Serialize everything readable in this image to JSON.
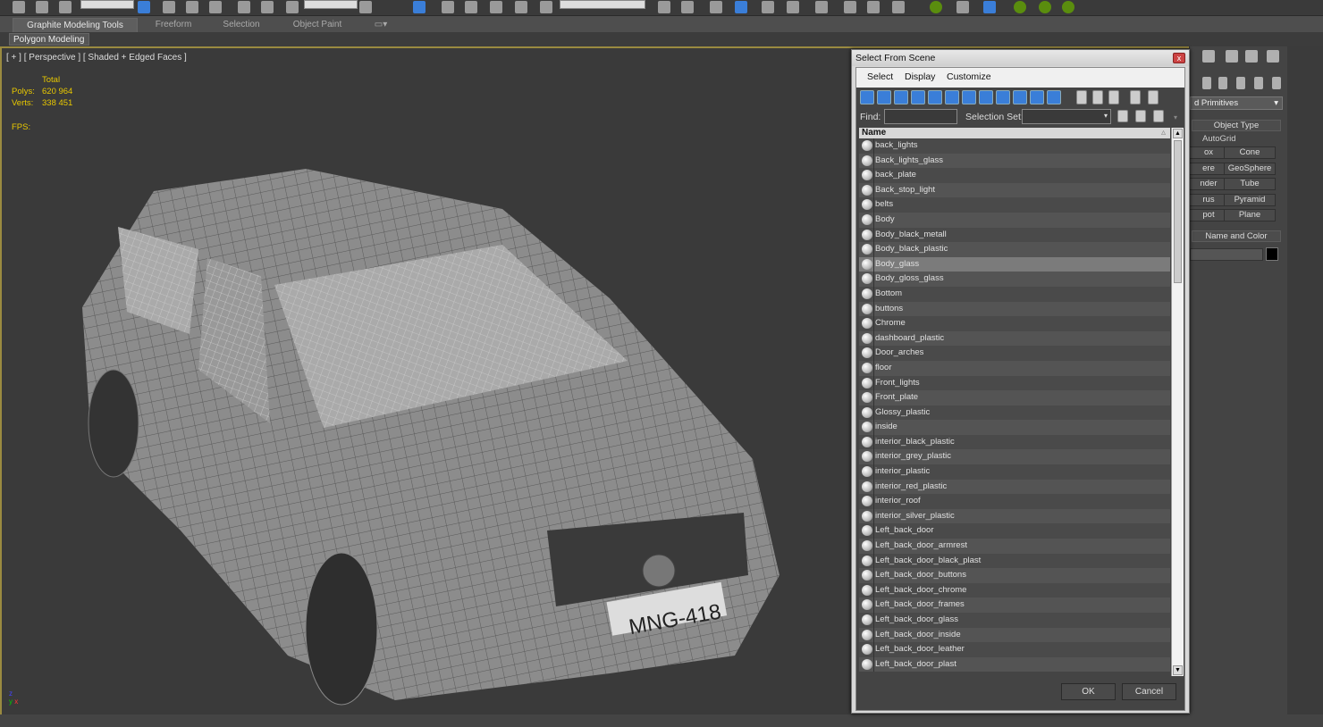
{
  "ribbon": {
    "tabs": [
      "Graphite Modeling Tools",
      "Freeform",
      "Selection",
      "Object Paint"
    ],
    "active": 0,
    "sub_label": "Polygon Modeling"
  },
  "viewport": {
    "label": "[ + ] [ Perspective ] [ Shaded + Edged Faces ]",
    "stats": {
      "total_label": "Total",
      "polys_label": "Polys:",
      "polys": "620 964",
      "verts_label": "Verts:",
      "verts": "338 451",
      "fps_label": "FPS:"
    },
    "plate": "MNG-418",
    "stats_color": "#e8c800",
    "border_color": "#9a8a40"
  },
  "command_panel": {
    "category": "d Primitives",
    "object_type": "Object Type",
    "autogrid": "AutoGrid",
    "buttons": [
      [
        "ox",
        "Cone"
      ],
      [
        "ere",
        "GeoSphere"
      ],
      [
        "nder",
        "Tube"
      ],
      [
        "rus",
        "Pyramid"
      ],
      [
        "pot",
        "Plane"
      ]
    ],
    "name_and_color": "Name and Color",
    "swatch_color": "#000000"
  },
  "dialog": {
    "title": "Select From Scene",
    "close": "x",
    "menus": [
      "Select",
      "Display",
      "Customize"
    ],
    "find_label": "Find:",
    "find_value": "",
    "selection_set_label": "Selection Set:",
    "selection_set_value": "",
    "column_header": "Name",
    "selected_index": 8,
    "items": [
      "back_lights",
      "Back_lights_glass",
      "back_plate",
      "Back_stop_light",
      "belts",
      "Body",
      "Body_black_metall",
      "Body_black_plastic",
      "Body_glass",
      "Body_gloss_glass",
      "Bottom",
      "buttons",
      "Chrome",
      "dashboard_plastic",
      "Door_arches",
      "floor",
      "Front_lights",
      "Front_plate",
      "Glossy_plastic",
      "inside",
      "interior_black_plastic",
      "interior_grey_plastic",
      "interior_plastic",
      "interior_red_plastic",
      "interior_roof",
      "interior_silver_plastic",
      "Left_back_door",
      "Left_back_door_armrest",
      "Left_back_door_black_plast",
      "Left_back_door_buttons",
      "Left_back_door_chrome",
      "Left_back_door_frames",
      "Left_back_door_glass",
      "Left_back_door_inside",
      "Left_back_door_leather",
      "Left_back_door_plast"
    ],
    "ok": "OK",
    "cancel": "Cancel"
  }
}
